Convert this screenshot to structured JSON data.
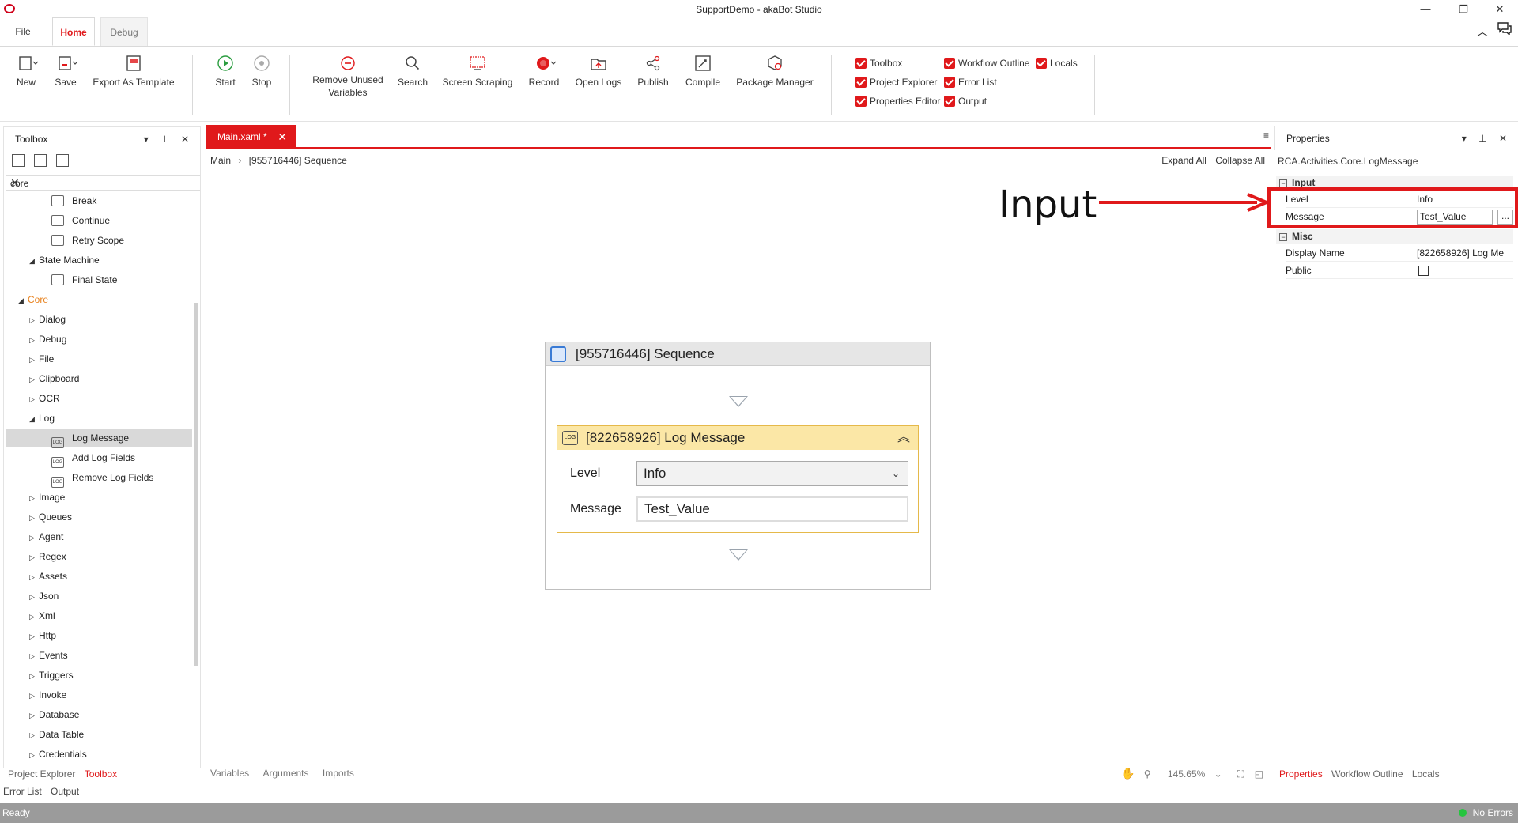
{
  "window": {
    "title": "SupportDemo - akaBot Studio",
    "minimize": "—",
    "restore": "❐",
    "close": "✕"
  },
  "ribbon_tabs": [
    {
      "label": "File"
    },
    {
      "label": "Home"
    },
    {
      "label": "Debug"
    }
  ],
  "ribbon": {
    "new": "New",
    "save": "Save",
    "export_template": "Export As Template",
    "start": "Start",
    "stop": "Stop",
    "remove_unused_line1": "Remove Unused",
    "remove_unused_line2": "Variables",
    "search": "Search",
    "screen_scraping": "Screen Scraping",
    "record": "Record",
    "open_logs": "Open Logs",
    "publish": "Publish",
    "compile": "Compile",
    "package_manager": "Package Manager",
    "toggles": {
      "toolbox": "Toolbox",
      "project_explorer": "Project Explorer",
      "properties_editor": "Properties Editor",
      "workflow_outline": "Workflow Outline",
      "error_list": "Error List",
      "output": "Output",
      "locals": "Locals"
    },
    "accent_color": "#e0191b"
  },
  "toolbox": {
    "title": "Toolbox",
    "search_value": "core",
    "tree": [
      {
        "label": "Break",
        "level": 3,
        "icon": "break-icon"
      },
      {
        "label": "Continue",
        "level": 3,
        "icon": "continue-icon"
      },
      {
        "label": "Retry Scope",
        "level": 3,
        "icon": "retry-icon"
      },
      {
        "label": "State Machine",
        "level": 2,
        "expanded": true
      },
      {
        "label": "Final State",
        "level": 3,
        "icon": "final-state-icon"
      },
      {
        "label": "Core",
        "level": 1,
        "expanded": true
      },
      {
        "label": "Dialog",
        "level": 2
      },
      {
        "label": "Debug",
        "level": 2
      },
      {
        "label": "File",
        "level": 2
      },
      {
        "label": "Clipboard",
        "level": 2
      },
      {
        "label": "OCR",
        "level": 2
      },
      {
        "label": "Log",
        "level": 2,
        "expanded": true
      },
      {
        "label": "Log Message",
        "level": 3,
        "icon": "log-icon",
        "selected": true
      },
      {
        "label": "Add Log Fields",
        "level": 3,
        "icon": "log-icon"
      },
      {
        "label": "Remove Log Fields",
        "level": 3,
        "icon": "log-icon"
      },
      {
        "label": "Image",
        "level": 2
      },
      {
        "label": "Queues",
        "level": 2
      },
      {
        "label": "Agent",
        "level": 2
      },
      {
        "label": "Regex",
        "level": 2
      },
      {
        "label": "Assets",
        "level": 2
      },
      {
        "label": "Json",
        "level": 2
      },
      {
        "label": "Xml",
        "level": 2
      },
      {
        "label": "Http",
        "level": 2
      },
      {
        "label": "Events",
        "level": 2
      },
      {
        "label": "Triggers",
        "level": 2
      },
      {
        "label": "Invoke",
        "level": 2
      },
      {
        "label": "Database",
        "level": 2
      },
      {
        "label": "Data Table",
        "level": 2
      },
      {
        "label": "Credentials",
        "level": 2
      }
    ],
    "bottom_tabs": {
      "project_explorer": "Project Explorer",
      "toolbox": "Toolbox",
      "error_list": "Error List",
      "output": "Output"
    }
  },
  "designer": {
    "doc_tab": "Main.xaml *",
    "breadcrumb": {
      "root": "Main",
      "sep": "›",
      "current": "[955716446] Sequence"
    },
    "expand_all": "Expand All",
    "collapse_all": "Collapse All",
    "sequence_title": "[955716446] Sequence",
    "log_message": {
      "title": "[822658926] Log Message",
      "level_label": "Level",
      "level_value": "Info",
      "message_label": "Message",
      "message_value": "Test_Value"
    },
    "bottom_tabs": {
      "variables": "Variables",
      "arguments": "Arguments",
      "imports": "Imports"
    },
    "zoom": "145.65%"
  },
  "properties": {
    "title": "Properties",
    "type": "RCA.Activities.Core.LogMessage",
    "categories": {
      "input": "Input",
      "misc": "Misc"
    },
    "rows": {
      "level_label": "Level",
      "level_value": "Info",
      "message_label": "Message",
      "message_value": "Test_Value",
      "display_name_label": "Display Name",
      "display_name_value": "[822658926] Log Me",
      "public_label": "Public"
    },
    "bottom_tabs": {
      "properties": "Properties",
      "workflow_outline": "Workflow Outline",
      "locals": "Locals"
    }
  },
  "annotation": {
    "text": "Input"
  },
  "status": {
    "left": "Ready",
    "right": "No Errors"
  }
}
